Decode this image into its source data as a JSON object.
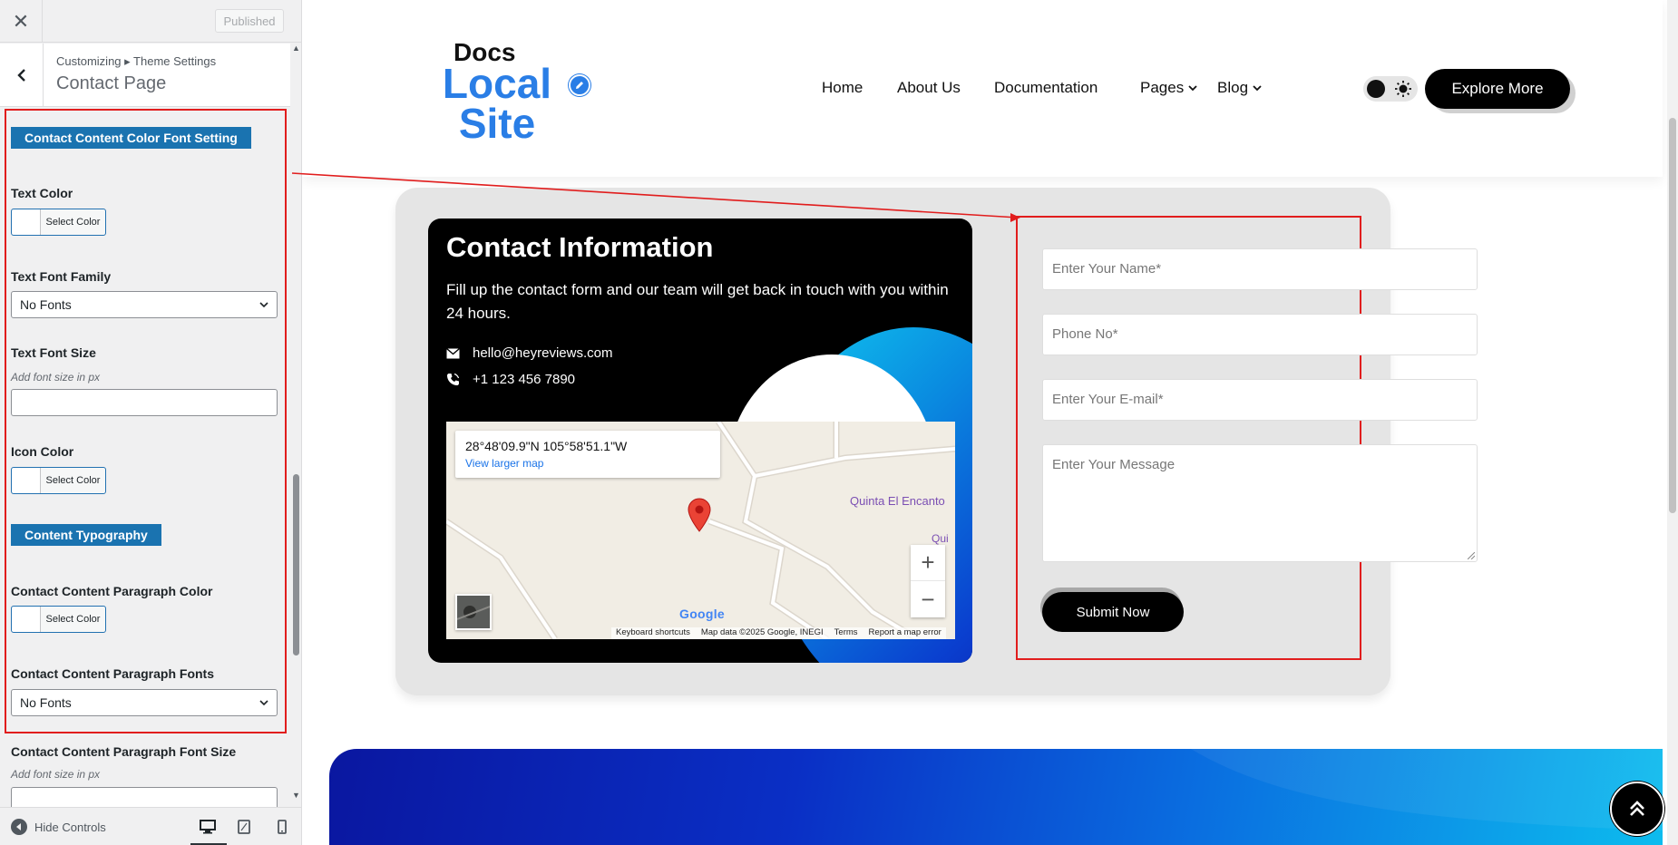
{
  "sidebar": {
    "close_glyph": "✕",
    "published_label": "Published",
    "breadcrumb": "Customizing ▸ Theme Settings",
    "section_title": "Contact Page",
    "headings": {
      "color_font": "Contact Content Color Font Setting",
      "typography": "Content Typography"
    },
    "controls": {
      "text_color": "Text Color",
      "text_font_family": "Text Font Family",
      "text_font_size": "Text Font Size",
      "icon_color": "Icon Color",
      "para_color": "Contact Content Paragraph Color",
      "para_fonts": "Contact Content Paragraph Fonts",
      "para_font_size": "Contact Content Paragraph Font Size"
    },
    "font_size_hint": "Add font size in px",
    "select_color_label": "Select Color",
    "no_fonts": "No Fonts",
    "hide_controls_label": "Hide Controls",
    "devices": [
      "desktop-icon",
      "tablet-icon",
      "mobile-icon"
    ],
    "colors": {
      "accent": "#2271b1",
      "heading": "#1a73b0",
      "highlight": "#e11d1d"
    }
  },
  "site": {
    "logo_line1": "Docs",
    "logo_line2": "Local",
    "logo_line3": "Site",
    "nav": [
      "Home",
      "About Us",
      "Documentation",
      "Pages",
      "Blog"
    ],
    "explore_label": "Explore More",
    "colors": {
      "brand_blue": "#2a7ee6",
      "dark": "#000000"
    }
  },
  "contact": {
    "title": "Contact Information",
    "text": "Fill up the contact form and our team will get back in touch with you within 24 hours.",
    "email": "hello@heyreviews.com",
    "phone": "+1 123 456 7890",
    "map": {
      "coords": "28°48'09.9\"N 105°58'51.1\"W",
      "larger_map": "View larger map",
      "place_label": "Quinta El Encanto",
      "place_label2": "Qui",
      "google": "Google",
      "footer": [
        "Keyboard shortcuts",
        "Map data ©2025 Google, INEGI",
        "Terms",
        "Report a map error"
      ]
    },
    "form": {
      "name_placeholder": "Enter Your Name*",
      "phone_placeholder": "Phone No*",
      "email_placeholder": "Enter Your E-mail*",
      "message_placeholder": "Enter Your Message",
      "submit_label": "Submit Now"
    }
  }
}
